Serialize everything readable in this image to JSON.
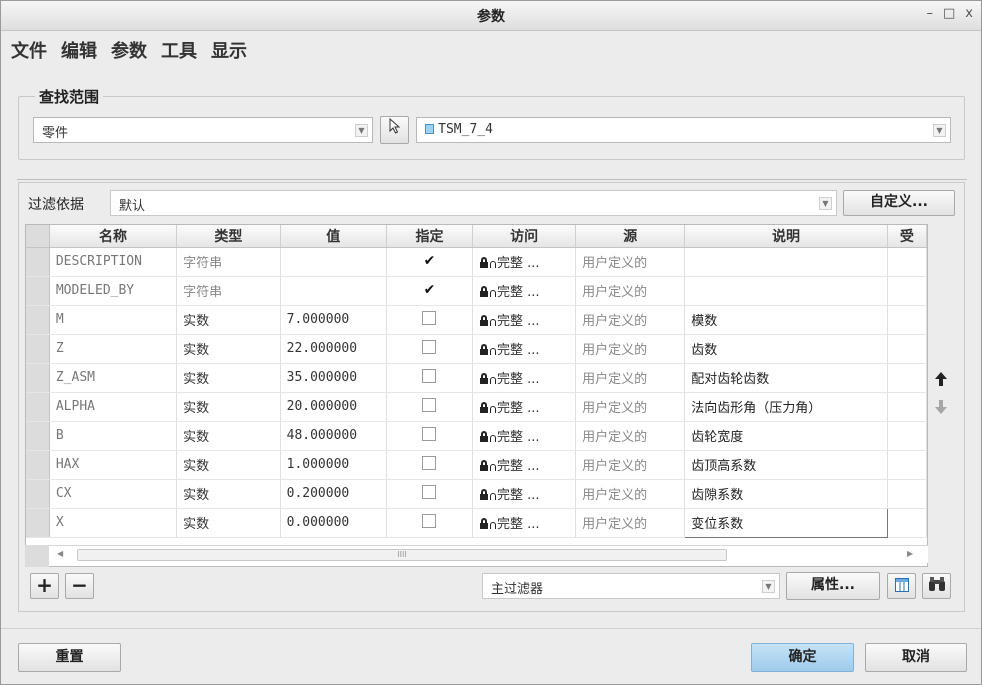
{
  "window": {
    "title": "参数",
    "controls": [
      "–",
      "□",
      "x"
    ]
  },
  "menu": [
    "文件",
    "编辑",
    "参数",
    "工具",
    "显示"
  ],
  "scope": {
    "title": "查找范围",
    "type_value": "零件",
    "model_value": "TSM_7_4"
  },
  "filter": {
    "label": "过滤依据",
    "value": "默认",
    "custom_label": "自定义..."
  },
  "table": {
    "columns": [
      "名称",
      "类型",
      "值",
      "指定",
      "访问",
      "源",
      "说明",
      "受"
    ],
    "rows": [
      {
        "name": "DESCRIPTION",
        "type": "字符串",
        "value": "",
        "designated": true,
        "access": "完整 ...",
        "source": "用户定义的",
        "desc": ""
      },
      {
        "name": "MODELED_BY",
        "type": "字符串",
        "value": "",
        "designated": true,
        "access": "完整 ...",
        "source": "用户定义的",
        "desc": ""
      },
      {
        "name": "M",
        "type": "实数",
        "value": "7.000000",
        "designated": false,
        "access": "完整 ...",
        "source": "用户定义的",
        "desc": "模数"
      },
      {
        "name": "Z",
        "type": "实数",
        "value": "22.000000",
        "designated": false,
        "access": "完整 ...",
        "source": "用户定义的",
        "desc": "齿数"
      },
      {
        "name": "Z_ASM",
        "type": "实数",
        "value": "35.000000",
        "designated": false,
        "access": "完整 ...",
        "source": "用户定义的",
        "desc": "配对齿轮齿数"
      },
      {
        "name": "ALPHA",
        "type": "实数",
        "value": "20.000000",
        "designated": false,
        "access": "完整 ...",
        "source": "用户定义的",
        "desc": "法向齿形角（压力角）"
      },
      {
        "name": "B",
        "type": "实数",
        "value": "48.000000",
        "designated": false,
        "access": "完整 ...",
        "source": "用户定义的",
        "desc": "齿轮宽度"
      },
      {
        "name": "HAX",
        "type": "实数",
        "value": "1.000000",
        "designated": false,
        "access": "完整 ...",
        "source": "用户定义的",
        "desc": "齿顶高系数"
      },
      {
        "name": "CX",
        "type": "实数",
        "value": "0.200000",
        "designated": false,
        "access": "完整 ...",
        "source": "用户定义的",
        "desc": "齿隙系数"
      },
      {
        "name": "X",
        "type": "实数",
        "value": "0.000000",
        "designated": false,
        "access": "完整 ...",
        "source": "用户定义的",
        "desc": "变位系数"
      }
    ],
    "scroll_thumb_label": "IIII"
  },
  "bottom": {
    "filter_value": "主过滤器",
    "properties_label": "属性..."
  },
  "footer": {
    "reset_label": "重置",
    "ok_label": "确定",
    "cancel_label": "取消"
  },
  "colors": {
    "ok_button": "#a9d1ee",
    "window_bg": "#ececec"
  }
}
